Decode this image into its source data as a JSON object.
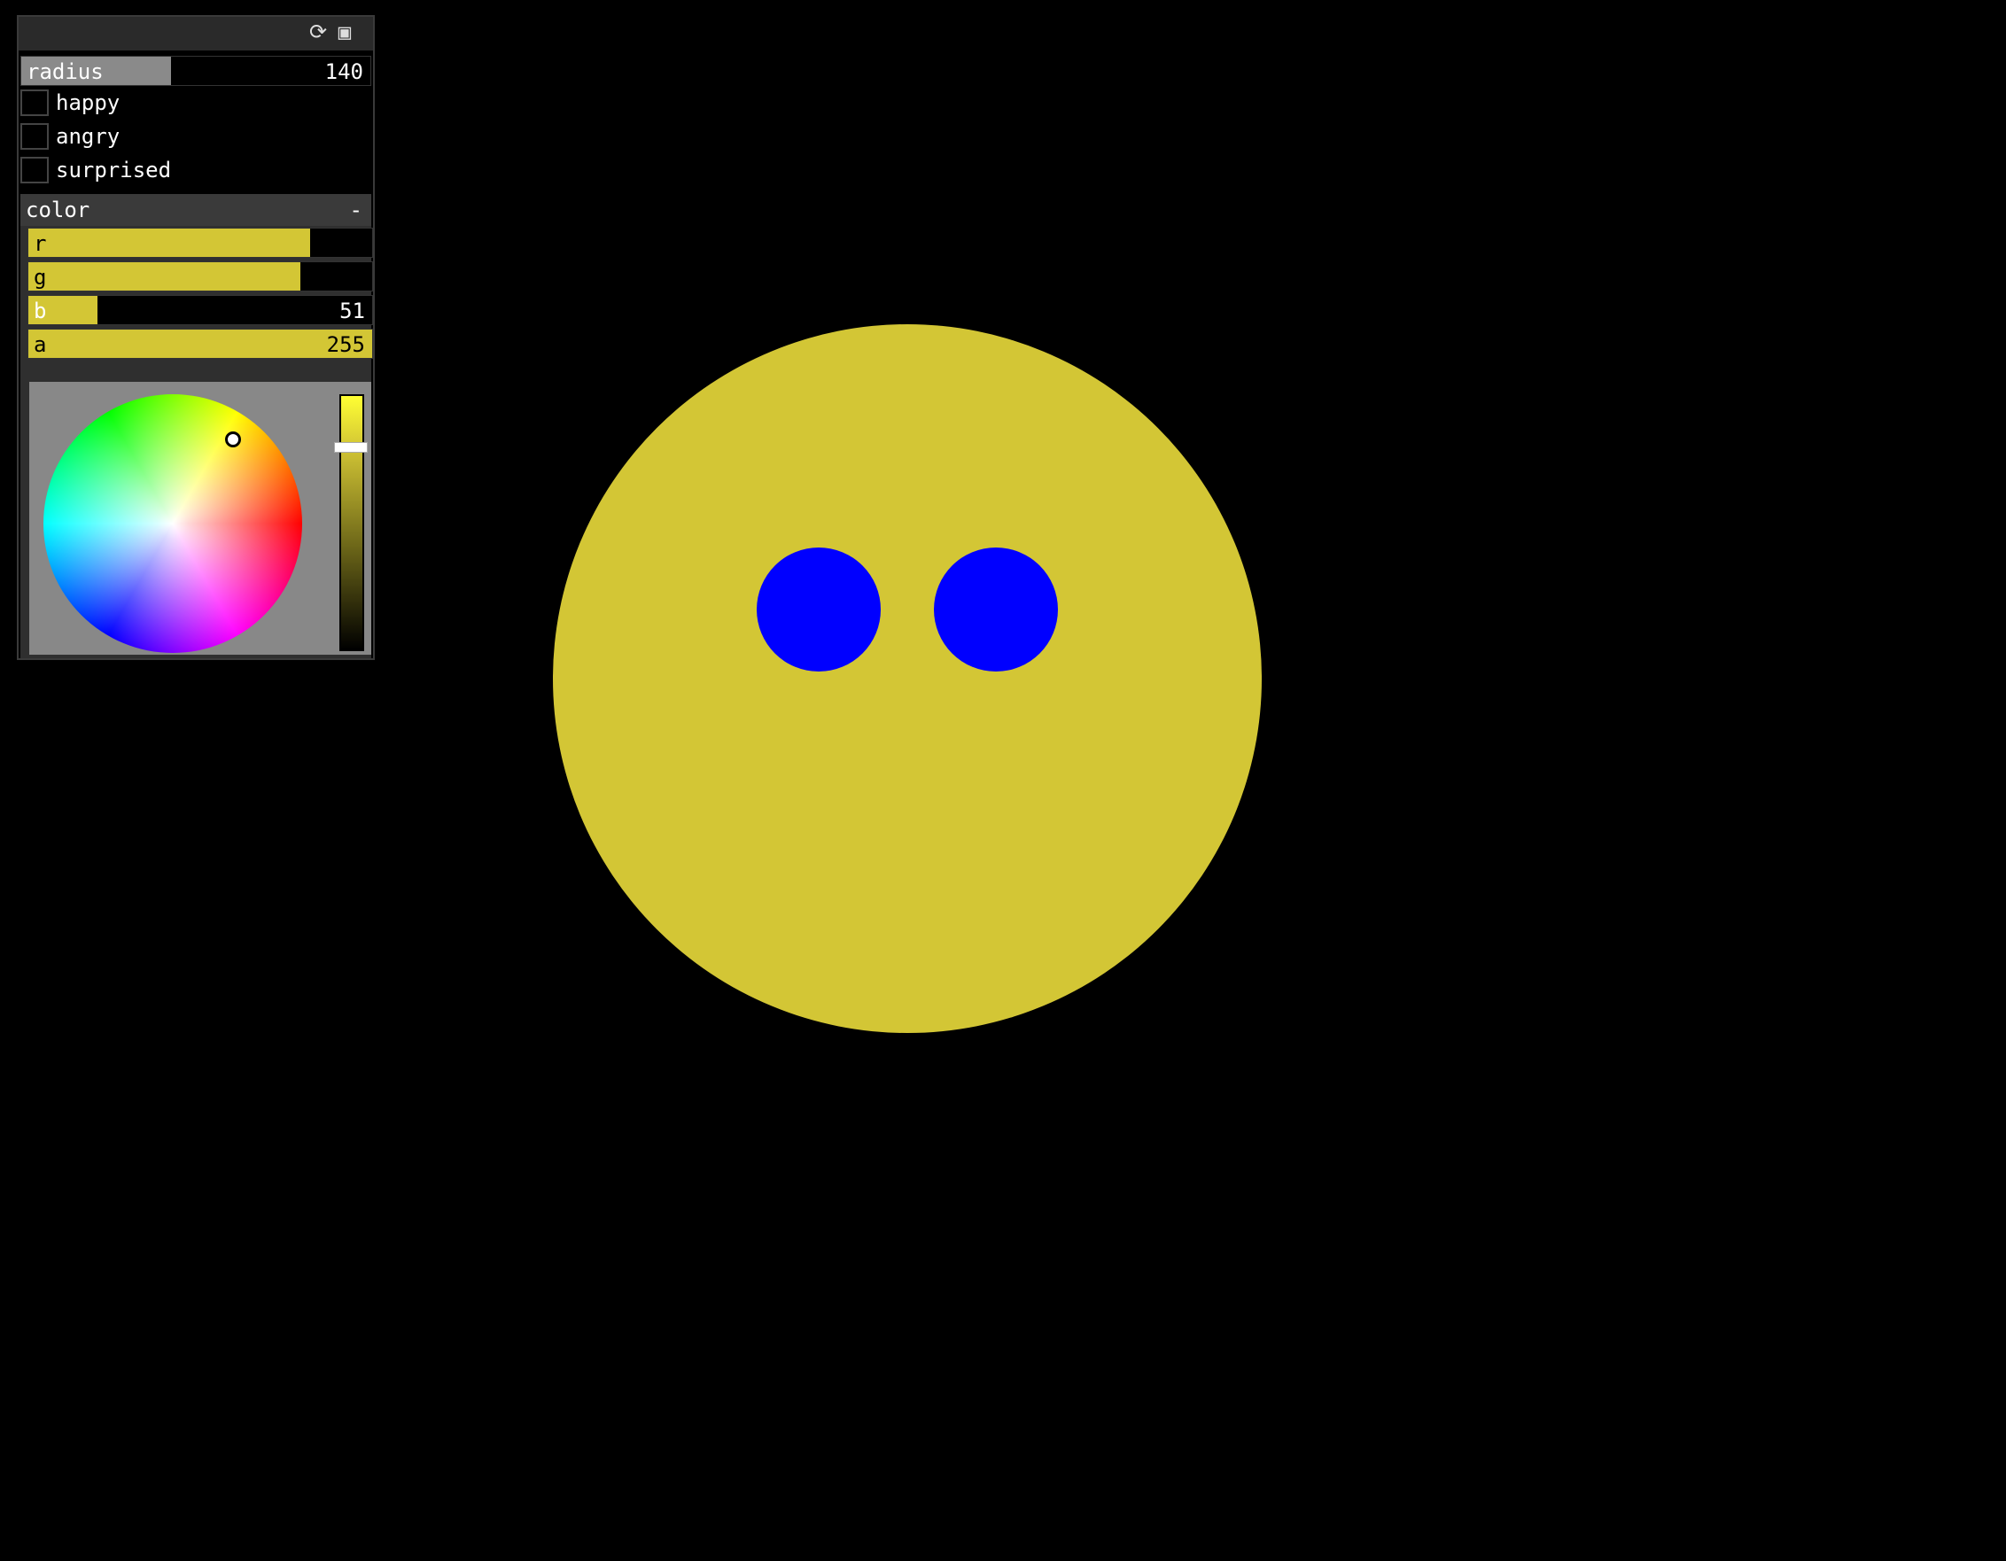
{
  "titlebar": {
    "reload_icon": "refresh-icon",
    "save_icon": "save-icon"
  },
  "params": {
    "radius": {
      "label": "radius",
      "value": "140",
      "fraction": 0.43
    },
    "toggles": [
      {
        "label": "happy",
        "checked": false
      },
      {
        "label": "angry",
        "checked": false
      },
      {
        "label": "surprised",
        "checked": false
      }
    ]
  },
  "color_group": {
    "title": "color",
    "collapse_symbol": "-",
    "channels": [
      {
        "label": "r",
        "value": "",
        "fraction": 0.82
      },
      {
        "label": "g",
        "value": "",
        "fraction": 0.79
      },
      {
        "label": "b",
        "value": "51",
        "fraction": 0.2
      },
      {
        "label": "a",
        "value": "255",
        "fraction": 1.0
      }
    ],
    "fill_color": "#d3c635"
  },
  "scene": {
    "face_color": "#d3c635",
    "eye_color": "#0000ff",
    "background": "#000000"
  }
}
